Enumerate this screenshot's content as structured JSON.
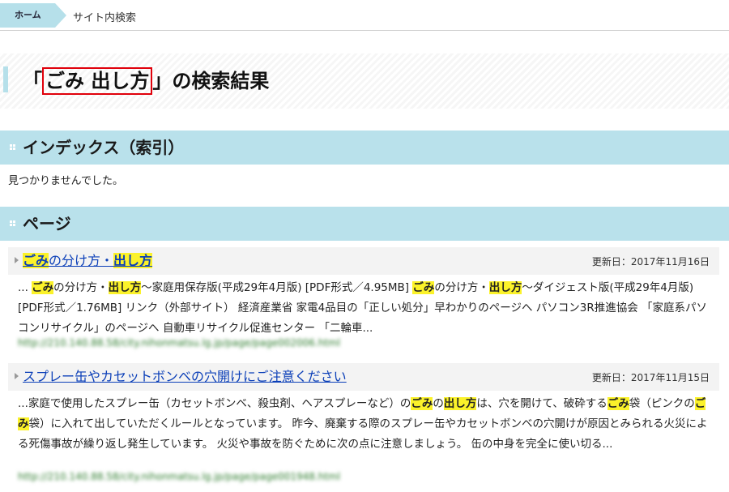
{
  "breadcrumb": {
    "home": "ホーム",
    "current": "サイト内検索"
  },
  "title": {
    "open": "「",
    "query": "ごみ 出し方",
    "close": "」の検索結果"
  },
  "sections": {
    "index": {
      "heading": "インデックス（索引）",
      "empty": "見つかりませんでした。"
    },
    "page": {
      "heading": "ページ"
    }
  },
  "results": [
    {
      "title_parts": [
        {
          "text": "ごみ",
          "hl": true
        },
        {
          "text": "の分け方・",
          "hl": false
        },
        {
          "text": "出し方",
          "hl": true
        }
      ],
      "date": "更新日：2017年11月16日",
      "snippet_parts": [
        {
          "text": "... ",
          "hl": false
        },
        {
          "text": "ごみ",
          "hl": true
        },
        {
          "text": "の分け方・",
          "hl": false
        },
        {
          "text": "出し方",
          "hl": true
        },
        {
          "text": "〜家庭用保存版(平成29年4月版) [PDF形式／4.95MB] ",
          "hl": false
        },
        {
          "text": "ごみ",
          "hl": true
        },
        {
          "text": "の分け方・",
          "hl": false
        },
        {
          "text": "出し方",
          "hl": true
        },
        {
          "text": "〜ダイジェスト版(平成29年4月版) [PDF形式／1.76MB] リンク（外部サイト） 経済産業省 家電4品目の「正しい処分」早わかりのページへ パソコン3R推進協会 「家庭系パソコンリサイクル」のページへ 自動車リサイクル促進センター 「二輪車...",
          "hl": false
        }
      ],
      "url": "http://210.140.88.58/city.nihonmatsu.lg.jp/page/page002006.html"
    },
    {
      "title_parts": [
        {
          "text": "スプレー缶やカセットボンベの穴開けにご注意ください",
          "hl": false
        }
      ],
      "date": "更新日：2017年11月15日",
      "snippet_parts": [
        {
          "text": "...家庭で使用したスプレー缶（カセットボンベ、殺虫剤、ヘアスプレーなど）の",
          "hl": false
        },
        {
          "text": "ごみ",
          "hl": true
        },
        {
          "text": "の",
          "hl": false
        },
        {
          "text": "出し方",
          "hl": true
        },
        {
          "text": "は、穴を開けて、破砕する",
          "hl": false
        },
        {
          "text": "ごみ",
          "hl": true
        },
        {
          "text": "袋（ピンクの",
          "hl": false
        },
        {
          "text": "ごみ",
          "hl": true
        },
        {
          "text": "袋）に入れて出していただくルールとなっています。 昨今、廃棄する際のスプレー缶やカセットボンベの穴開けが原因とみられる火災による死傷事故が繰り返し発生しています。 火災や事故を防ぐために次の点に注意しましょう。 缶の中身を完全に使い切る...",
          "hl": false
        }
      ],
      "url": "http://210.140.88.58/city.nihonmatsu.lg.jp/page/page001948.html"
    }
  ]
}
